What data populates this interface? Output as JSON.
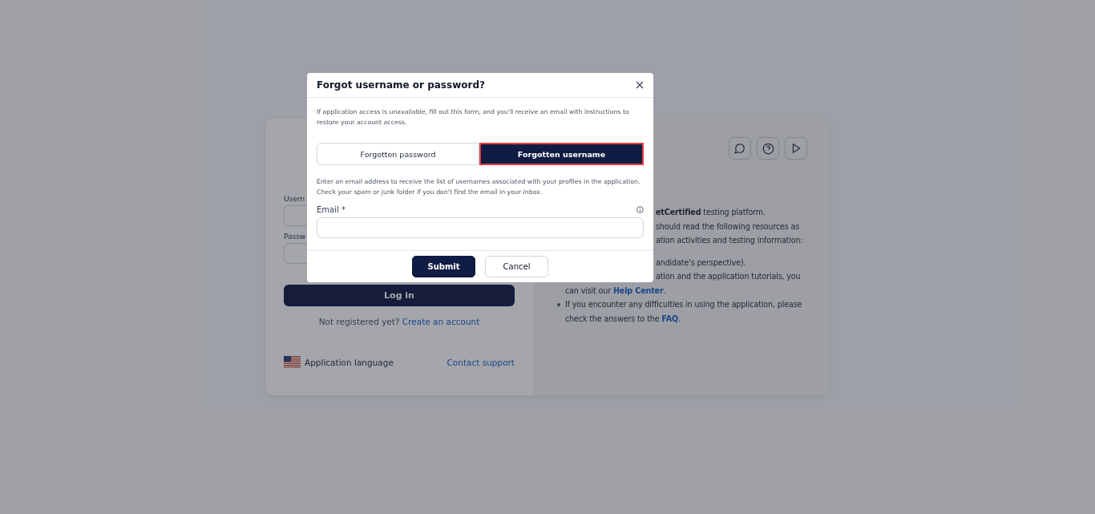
{
  "login": {
    "username_label": "Usern",
    "password_label": "Passw",
    "login_button": "Log in",
    "register_prompt": "Not registered yet?",
    "register_link": "Create an account",
    "language_label": "Application language",
    "contact_link": "Contact support"
  },
  "info": {
    "lines": [
      {
        "kind": "fragment",
        "text": "**etCertified** testing platform."
      },
      {
        "kind": "fragment",
        "text": "should read the following resources as"
      },
      {
        "kind": "fragment",
        "text": "ation activities and testing information:"
      },
      {
        "kind": "gap"
      },
      {
        "kind": "fragment",
        "text": "andidate's perspective)."
      },
      {
        "kind": "fragment",
        "text": "ation and the application tutorials, you"
      },
      {
        "kind": "plain",
        "text": "can visit our ",
        "link": "Help Center",
        "after": "."
      },
      {
        "kind": "bullet",
        "text": "If you encounter any difficulties in using the application, please"
      },
      {
        "kind": "plain",
        "text": "check the answers to the ",
        "link": "FAQ",
        "after": "."
      }
    ]
  },
  "dialog": {
    "title": "Forgot username or password?",
    "intro": "If application access is unavailable, fill out this form, and you'll receive an email with instructions to restore your account access.",
    "tabs": [
      {
        "label": "Forgotten password",
        "selected": false
      },
      {
        "label": "Forgotten username",
        "selected": true
      }
    ],
    "instruction": "Enter an email address to receive the list of usernames associated with your profiles in the application. Check your spam or junk folder if you don't find the email in your inbox.",
    "email_label": "Email",
    "required_mark": "*",
    "buttons": [
      {
        "kind": "primary",
        "label": "Submit"
      },
      {
        "kind": "secondary",
        "label": "Cancel"
      }
    ]
  }
}
